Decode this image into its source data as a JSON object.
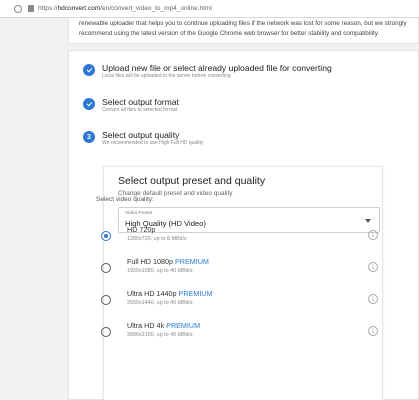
{
  "browser": {
    "url_scheme": "https://",
    "url_host": "hdconvert.com",
    "url_path": "/en/convert_video_to_mp4_online.html"
  },
  "notice": {
    "line1": "renewable uploader that helps you to continue uploading files if the network was lost for some reason, but we strongly",
    "line2": "recommend using the latest version of the Google Chrome web browser for better stability and compatibility."
  },
  "steps": [
    {
      "title": "Upload new file or select already uploaded file for converting",
      "subtitle": "Local files will be uploaded to the server before converting",
      "status": "done",
      "icon": "check-icon"
    },
    {
      "title": "Select output format",
      "subtitle": "Convert all files to selected format",
      "status": "done",
      "icon": "check-icon"
    },
    {
      "title": "Select output quality",
      "subtitle": "We recommended to use High Full HD quality",
      "status": "active",
      "number": "3"
    }
  ],
  "preset_panel": {
    "title": "Select output preset and quality",
    "subtitle": "Change default preset and video quality",
    "preset_label": "Video Preset",
    "preset_value": "High Quality (HD Video)",
    "quality_label": "Select video quality:"
  },
  "qualities": [
    {
      "name": "HD 720p",
      "premium": "",
      "detail": "1280x720, up to 8 MBit/s",
      "selected": true
    },
    {
      "name": "Full HD 1080p",
      "premium": "PREMIUM",
      "detail": "1920x1080, up to 40 MBit/s",
      "selected": false
    },
    {
      "name": "Ultra HD 1440p",
      "premium": "PREMIUM",
      "detail": "2560x1440, up to 40 MBit/s",
      "selected": false
    },
    {
      "name": "Ultra HD 4k",
      "premium": "PREMIUM",
      "detail": "3996x2160, up to 40 MBit/s",
      "selected": false
    }
  ],
  "colors": {
    "accent": "#2c78d4",
    "background": "#f2f2f2"
  }
}
